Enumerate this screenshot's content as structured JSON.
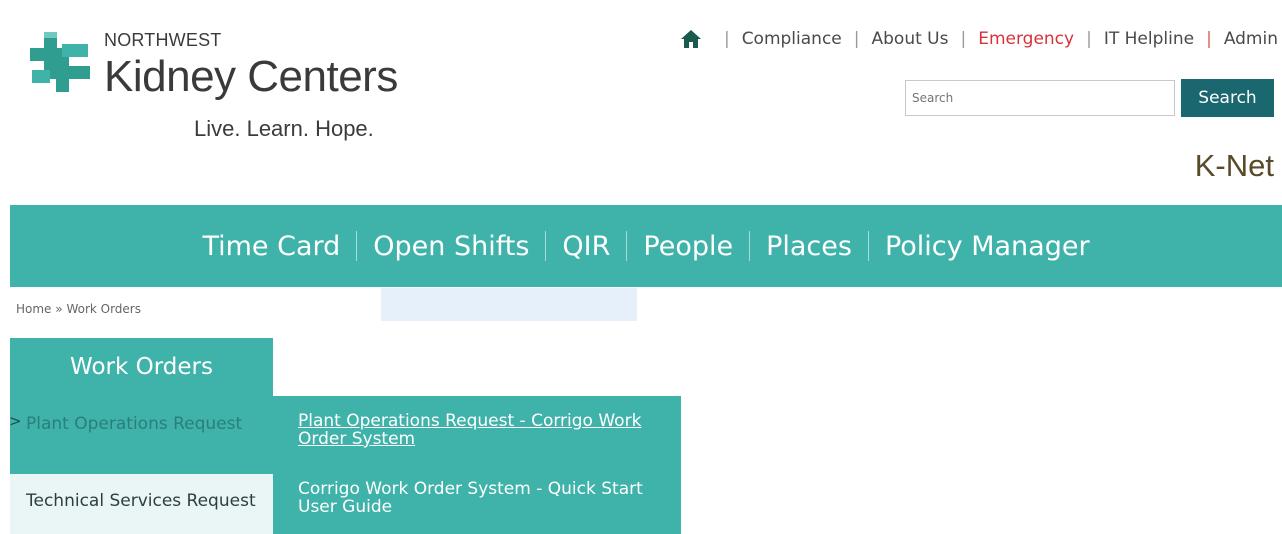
{
  "brand": {
    "org_prefix": "NORTHWEST",
    "org_name": "Kidney Centers",
    "tagline": "Live. Learn. Hope.",
    "site_name": "K-Net",
    "logo_icon": "kidney-centers-logo-icon"
  },
  "utility_nav": {
    "home_icon": "home-icon",
    "links": [
      "Compliance",
      "About Us",
      "Emergency",
      "IT Helpline",
      "Admin"
    ]
  },
  "search": {
    "placeholder": "Search",
    "button_label": "Search"
  },
  "main_nav": {
    "items": [
      "Time Card",
      "Open Shifts",
      "QIR",
      "People",
      "Places",
      "Policy Manager"
    ]
  },
  "breadcrumb": {
    "home": "Home",
    "separator": "»",
    "current": "Work Orders"
  },
  "sidebar": {
    "title": "Work Orders",
    "items": [
      {
        "label": "Plant Operations Request",
        "arrow": ">"
      },
      {
        "label": "Technical Services Request"
      }
    ]
  },
  "flyout": {
    "links": [
      "Plant Operations Request - Corrigo Work Order System",
      "Corrigo Work Order System - Quick Start User Guide"
    ]
  },
  "colors": {
    "teal": "#3fb3aa",
    "dark_teal": "#1a6770",
    "emergency_red": "#d6323b",
    "knet_brown": "#594a28"
  }
}
